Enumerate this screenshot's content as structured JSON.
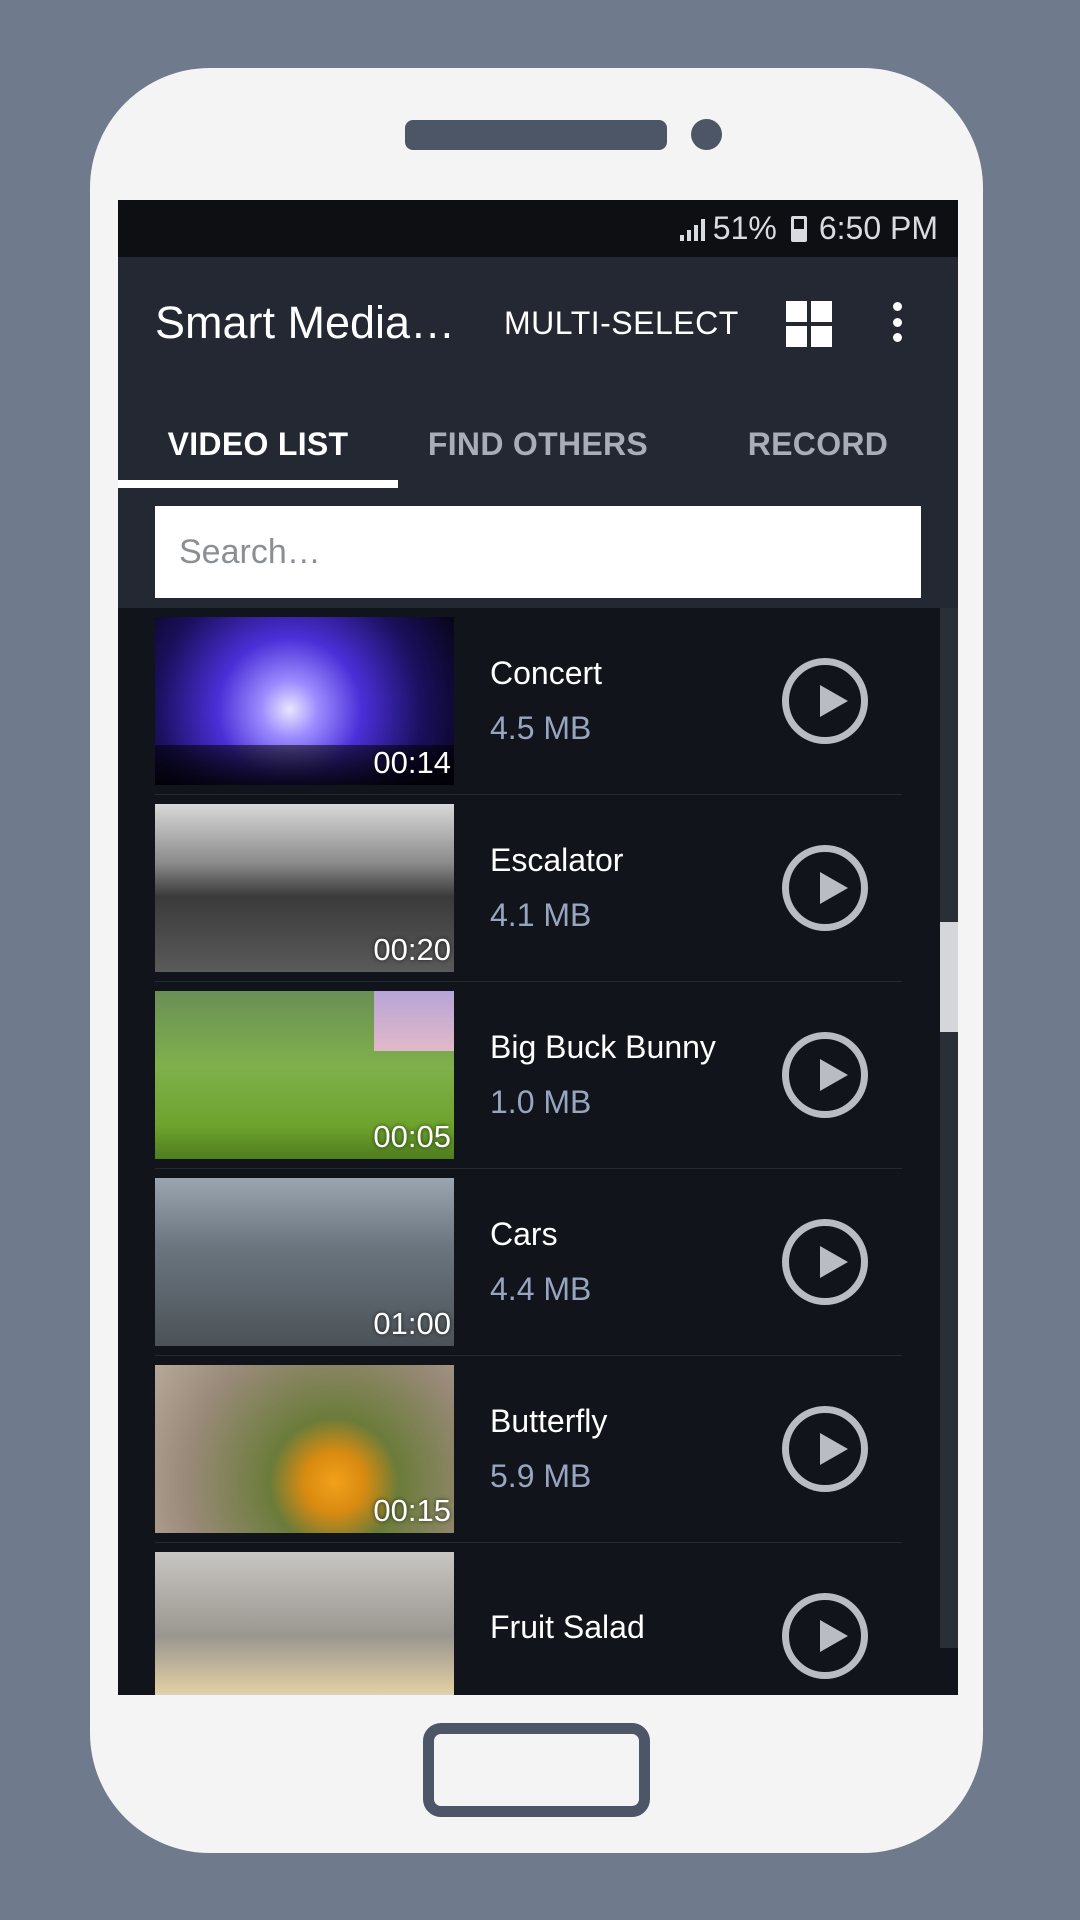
{
  "status_bar": {
    "battery": "51%",
    "time": "6:50 PM"
  },
  "toolbar": {
    "title": "Smart Media…",
    "multi_select": "MULTI-SELECT"
  },
  "tabs": [
    {
      "label": "VIDEO LIST",
      "active": true
    },
    {
      "label": "FIND OTHERS",
      "active": false
    },
    {
      "label": "RECORD",
      "active": false
    }
  ],
  "search": {
    "placeholder": "Search…"
  },
  "videos": [
    {
      "name": "Concert",
      "size": "4.5 MB",
      "duration": "00:14"
    },
    {
      "name": "Escalator",
      "size": "4.1 MB",
      "duration": "00:20"
    },
    {
      "name": "Big Buck Bunny",
      "size": "1.0 MB",
      "duration": "00:05"
    },
    {
      "name": "Cars",
      "size": "4.4 MB",
      "duration": "01:00"
    },
    {
      "name": "Butterfly",
      "size": "5.9 MB",
      "duration": "00:15"
    },
    {
      "name": "Fruit Salad",
      "size": "",
      "duration": ""
    }
  ],
  "colors": {
    "toolbar": "#232833",
    "list_background": "#11141a",
    "size_text": "#98a5c0",
    "play_icon": "#b9bcc2"
  }
}
